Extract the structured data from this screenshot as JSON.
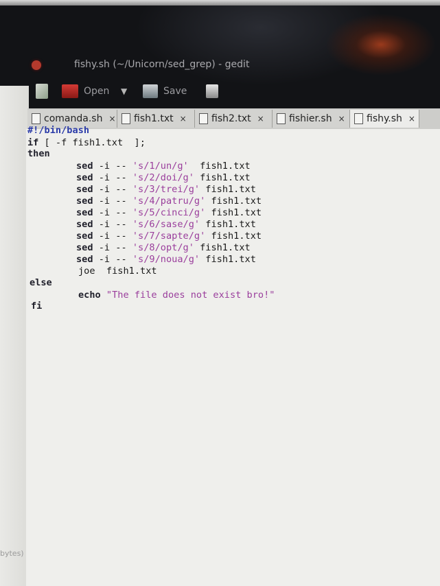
{
  "window": {
    "title": "fishy.sh (~/Unicorn/sed_grep) - gedit",
    "status_fragment": "bytes)"
  },
  "toolbar": {
    "open_label": "Open",
    "save_label": "Save"
  },
  "tabs": [
    {
      "label": "comanda.sh",
      "close": "×"
    },
    {
      "label": "fish1.txt",
      "close": "×"
    },
    {
      "label": "fish2.txt",
      "close": "×"
    },
    {
      "label": "fishier.sh",
      "close": "×"
    },
    {
      "label": "fishy.sh",
      "close": "×",
      "active": true
    }
  ],
  "code": {
    "shebang": "#!/bin/bash",
    "if_kw": "if",
    "if_rest": " [ -f fish1.txt  ];",
    "then_kw": "then",
    "sed_lines": [
      {
        "cmd": "sed",
        "flags": " -i -- ",
        "expr": "'s/1/un/g'",
        "file": "  fish1.txt"
      },
      {
        "cmd": "sed",
        "flags": " -i -- ",
        "expr": "'s/2/doi/g'",
        "file": " fish1.txt"
      },
      {
        "cmd": "sed",
        "flags": " -i -- ",
        "expr": "'s/3/trei/g'",
        "file": " fish1.txt"
      },
      {
        "cmd": "sed",
        "flags": " -i -- ",
        "expr": "'s/4/patru/g'",
        "file": " fish1.txt"
      },
      {
        "cmd": "sed",
        "flags": " -i -- ",
        "expr": "'s/5/cinci/g'",
        "file": " fish1.txt"
      },
      {
        "cmd": "sed",
        "flags": " -i -- ",
        "expr": "'s/6/sase/g'",
        "file": " fish1.txt"
      },
      {
        "cmd": "sed",
        "flags": " -i -- ",
        "expr": "'s/7/sapte/g'",
        "file": " fish1.txt"
      },
      {
        "cmd": "sed",
        "flags": " -i -- ",
        "expr": "'s/8/opt/g'",
        "file": " fish1.txt"
      },
      {
        "cmd": "sed",
        "flags": " -i -- ",
        "expr": "'s/9/noua/g'",
        "file": " fish1.txt"
      }
    ],
    "joe_line": "joe  fish1.txt",
    "else_kw": "else",
    "echo_kw": "echo",
    "echo_str": " \"The file does not exist bro!\"",
    "fi_kw": "fi"
  },
  "colors": {
    "string": "#9a3e9c",
    "shebang": "#2a3aa8",
    "editor_bg": "#efefec"
  }
}
